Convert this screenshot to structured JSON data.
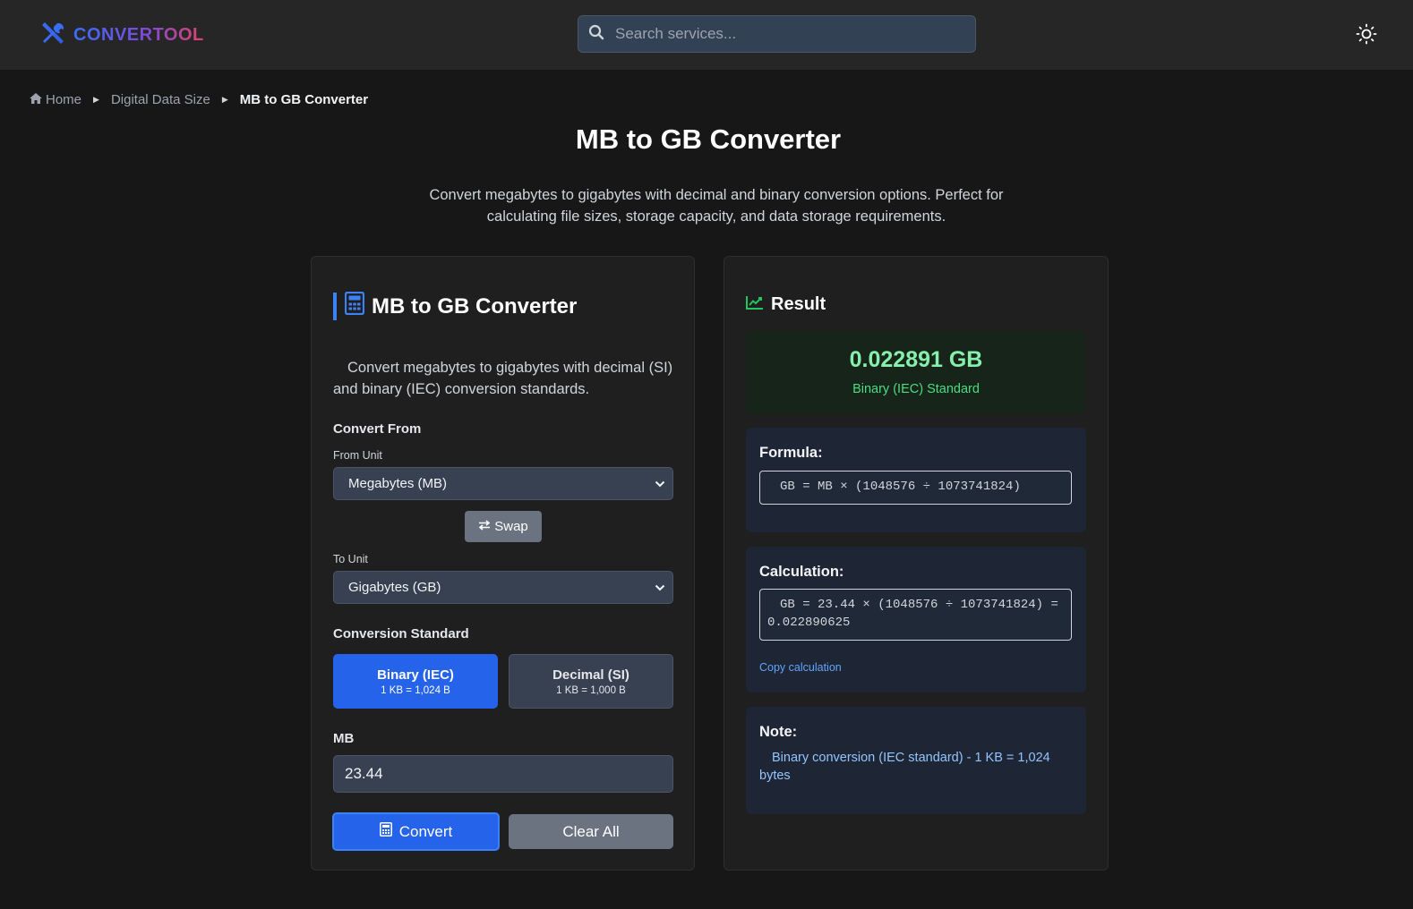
{
  "header": {
    "brand": "CONVERTOOL",
    "search_placeholder": "Search services..."
  },
  "breadcrumb": {
    "home": "Home",
    "category": "Digital Data Size",
    "current": "MB to GB Converter"
  },
  "page": {
    "title": "MB to GB Converter",
    "description": "Convert megabytes to gigabytes with decimal and binary conversion options. Perfect for calculating file sizes, storage capacity, and data storage requirements."
  },
  "converter": {
    "title": "MB to GB Converter",
    "intro": "Convert megabytes to gigabytes with decimal (SI) and binary (IEC) conversion standards.",
    "convert_from_label": "Convert From",
    "from_unit_label": "From Unit",
    "from_unit_value": "Megabytes (MB)",
    "swap_label": "Swap",
    "to_unit_label": "To Unit",
    "to_unit_value": "Gigabytes (GB)",
    "standard_label": "Conversion Standard",
    "standards": [
      {
        "name": "Binary (IEC)",
        "sub": "1 KB = 1,024 B",
        "selected": true
      },
      {
        "name": "Decimal (SI)",
        "sub": "1 KB = 1,000 B",
        "selected": false
      }
    ],
    "input_label": "MB",
    "input_value": "23.44",
    "convert_label": "Convert",
    "clear_label": "Clear All"
  },
  "result": {
    "title": "Result",
    "value": "0.022891 GB",
    "standard": "Binary (IEC) Standard",
    "formula_title": "Formula:",
    "formula": "GB = MB × (1048576 ÷ 1073741824)",
    "calculation_title": "Calculation:",
    "calculation": "GB = 23.44 × (1048576 ÷ 1073741824) = 0.022890625",
    "copy_label": "Copy calculation",
    "note_title": "Note:",
    "note": "Binary conversion (IEC standard) - 1 KB = 1,024 bytes"
  },
  "colors": {
    "accent": "#2563eb",
    "result_green": "#86efac",
    "background": "#171717",
    "card": "#1f1f1f"
  }
}
